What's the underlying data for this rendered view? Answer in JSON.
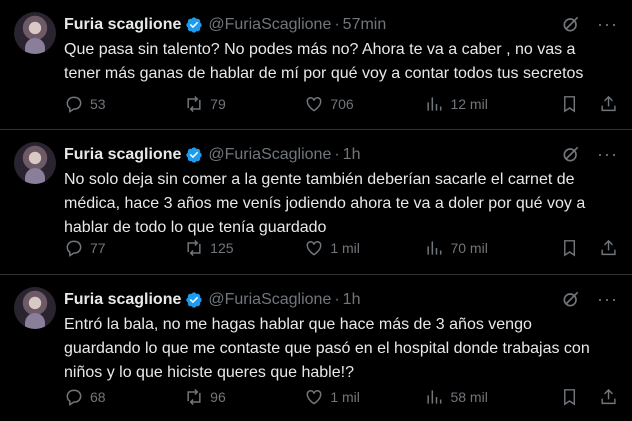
{
  "tweets": [
    {
      "name": "Furia scaglione",
      "handle": "@FuriaScaglione",
      "time": "57min",
      "text": "Que pasa sin talento? No podes más no? Ahora te va a caber , no vas a\ntener más ganas de hablar de mí por qué voy a contar todos tus secretos",
      "replies": "53",
      "retweets": "79",
      "likes": "706",
      "views": "12 mil"
    },
    {
      "name": "Furia scaglione",
      "handle": "@FuriaScaglione",
      "time": "1h",
      "text": "No solo deja sin comer a la gente también deberían sacarle el carnet de\nmédica, hace 3 años me venís jodiendo ahora te va a doler por qué voy a\nhablar de todo lo que tenía guardado",
      "replies": "77",
      "retweets": "125",
      "likes": "1 mil",
      "views": "70 mil"
    },
    {
      "name": "Furia scaglione",
      "handle": "@FuriaScaglione",
      "time": "1h",
      "text": "Entró la bala, no me hagas hablar que hace más de 3 años vengo\nguardando lo que me contaste que pasó en el hospital donde trabajas con\nniños y lo que hiciste queres que hable!?",
      "replies": "68",
      "retweets": "96",
      "likes": "1 mil",
      "views": "58 mil"
    }
  ],
  "separator": "·",
  "icons": {
    "verified": "verified-badge-icon",
    "grok": "grok-icon",
    "more": "more-icon",
    "reply": "reply-icon",
    "retweet": "retweet-icon",
    "like": "like-icon",
    "views": "views-icon",
    "bookmark": "bookmark-icon",
    "share": "share-icon"
  },
  "colors": {
    "background": "#000000",
    "text": "#e7e9ea",
    "muted": "#71767b",
    "verified": "#1d9bf0",
    "divider": "#2f3336"
  }
}
